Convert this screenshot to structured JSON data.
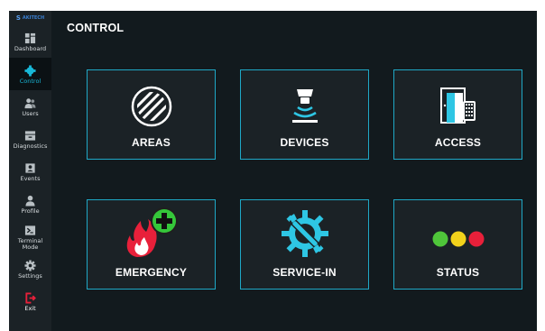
{
  "app": {
    "logo_text": "AKITECH",
    "page_title": "CONTROL"
  },
  "colors": {
    "accent": "#18b8d8",
    "tile_border": "#1fa8c6",
    "exit": "#e8203a"
  },
  "sidebar": {
    "items": [
      {
        "label": "Dashboard",
        "icon": "dashboard-icon"
      },
      {
        "label": "Control",
        "icon": "control-gear-icon",
        "active": true
      },
      {
        "label": "Users",
        "icon": "users-icon"
      },
      {
        "label": "Diagnostics",
        "icon": "diagnostics-icon"
      },
      {
        "label": "Events",
        "icon": "events-icon"
      },
      {
        "label": "Profile",
        "icon": "profile-icon"
      },
      {
        "label": "Terminal\nMode",
        "icon": "terminal-icon"
      },
      {
        "label": "Settings",
        "icon": "settings-icon"
      },
      {
        "label": "Exit",
        "icon": "exit-icon"
      }
    ]
  },
  "tiles": [
    {
      "label": "AREAS",
      "icon": "areas-icon"
    },
    {
      "label": "DEVICES",
      "icon": "devices-icon"
    },
    {
      "label": "ACCESS",
      "icon": "access-icon"
    },
    {
      "label": "EMERGENCY",
      "icon": "emergency-icon"
    },
    {
      "label": "SERVICE-IN",
      "icon": "service-tools-icon"
    },
    {
      "label": "STATUS",
      "icon": "status-lights-icon",
      "lights": [
        "#4fc63a",
        "#f2d21b",
        "#e8203a"
      ]
    }
  ]
}
